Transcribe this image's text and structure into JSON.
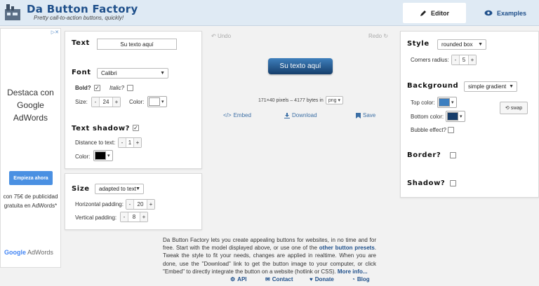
{
  "header": {
    "brand": "Da Button Factory",
    "tagline": "Pretty call-to-action buttons, quickly!",
    "tabs": [
      {
        "label": "Editor",
        "icon": "pencil-icon"
      },
      {
        "label": "Examples",
        "icon": "eye-icon"
      }
    ]
  },
  "ad": {
    "heading": "Destaca con Google AdWords",
    "button": "Empieza ahora",
    "offer": "con 75€ de publicidad gratuita en AdWords*",
    "logo_google": "Google",
    "logo_adwords": "AdWords"
  },
  "text_panel": {
    "text_title": "Text",
    "text_value": "Su texto aquí",
    "font_title": "Font",
    "font_value": "Calibri",
    "bold_label": "Bold?",
    "bold_checked": true,
    "italic_label": "Italic?",
    "italic_checked": false,
    "size_label": "Size:",
    "size_value": "24",
    "color_label": "Color:",
    "color_value": "#ffffff",
    "shadow_title": "Text shadow?",
    "shadow_checked": true,
    "distance_label": "Distance to text:",
    "distance_value": "1",
    "shadow_color_label": "Color:",
    "shadow_color_value": "#000000"
  },
  "size_panel": {
    "title": "Size",
    "mode": "adapted to text",
    "h_padding_label": "Horizontal padding:",
    "h_padding_value": "20",
    "v_padding_label": "Vertical padding:",
    "v_padding_value": "8"
  },
  "center": {
    "undo": "Undo",
    "redo": "Redo",
    "preview_text": "Su texto aquí",
    "size_info": "171×40 pixels – 4177 bytes in",
    "format": "png",
    "embed": "Embed",
    "download": "Download",
    "save": "Save"
  },
  "style_panel": {
    "style_title": "Style",
    "style_value": "rounded box",
    "corners_label": "Corners radius:",
    "corners_value": "5",
    "background_title": "Background",
    "background_value": "simple gradient",
    "top_color_label": "Top color:",
    "top_color_value": "#3d7fc0",
    "bottom_color_label": "Bottom color:",
    "bottom_color_value": "#163d6a",
    "swap_label": "swap",
    "bubble_label": "Bubble effect?",
    "border_title": "Border?",
    "shadow_title": "Shadow?"
  },
  "description": {
    "part1": "Da Button Factory lets you create appealing buttons for websites, in no time and for free. Start with the model displayed above, or use one of the ",
    "link1": "other button presets",
    "part2": ". Tweak the style to fit your needs, changes are applied in realtime. When you are done, use the \"Download\" link to get the button image to your computer, or click \"Embed\" to directly integrate the button on a website (hotlink or CSS). ",
    "link2": "More info..."
  },
  "footer": {
    "links": [
      "API",
      "Contact",
      "Donate",
      "Blog"
    ]
  }
}
